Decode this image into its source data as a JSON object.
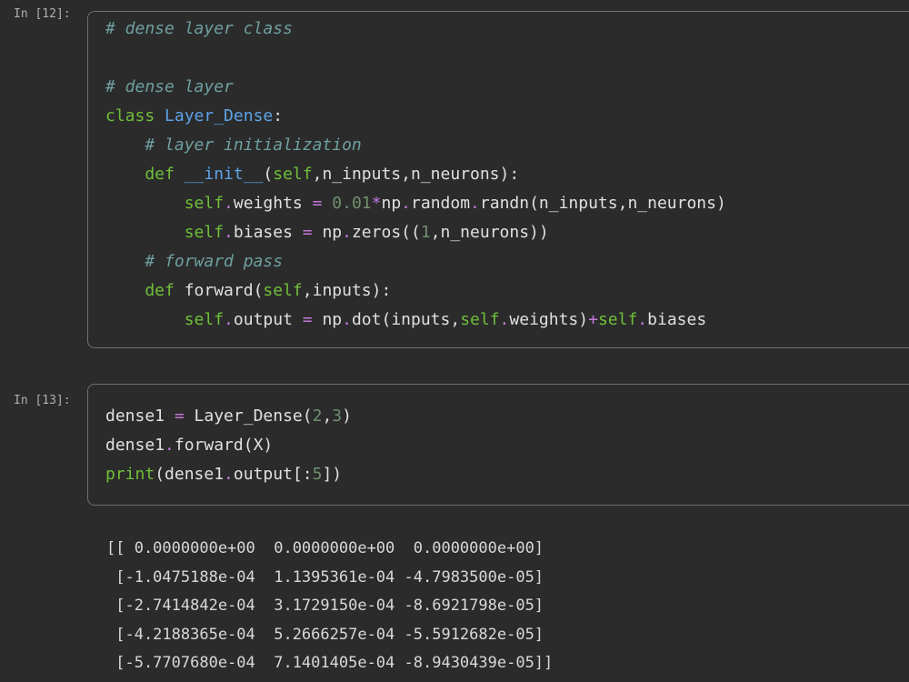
{
  "cells": [
    {
      "prompt": "In [12]:",
      "lines": [
        [
          {
            "t": "# dense layer class",
            "c": "tok-comment"
          }
        ],
        [],
        [
          {
            "t": "# dense layer",
            "c": "tok-comment"
          }
        ],
        [
          {
            "t": "class ",
            "c": "tok-kw"
          },
          {
            "t": "Layer_Dense",
            "c": "tok-cls"
          },
          {
            "t": ":",
            "c": "tok-name"
          }
        ],
        [
          {
            "t": "    # layer initialization",
            "c": "tok-comment"
          }
        ],
        [
          {
            "t": "    def ",
            "c": "tok-kw"
          },
          {
            "t": "__init__",
            "c": "tok-fn"
          },
          {
            "t": "(",
            "c": "tok-name"
          },
          {
            "t": "self",
            "c": "tok-self"
          },
          {
            "t": ",n_inputs,n_neurons):",
            "c": "tok-name"
          }
        ],
        [
          {
            "t": "        self",
            "c": "tok-self"
          },
          {
            "t": ".",
            "c": "tok-op"
          },
          {
            "t": "weights ",
            "c": "tok-name"
          },
          {
            "t": "= ",
            "c": "tok-op"
          },
          {
            "t": "0.01",
            "c": "tok-num"
          },
          {
            "t": "*",
            "c": "tok-op"
          },
          {
            "t": "np",
            "c": "tok-name"
          },
          {
            "t": ".",
            "c": "tok-op"
          },
          {
            "t": "random",
            "c": "tok-name"
          },
          {
            "t": ".",
            "c": "tok-op"
          },
          {
            "t": "randn(n_inputs,n_neurons)",
            "c": "tok-name"
          }
        ],
        [
          {
            "t": "        self",
            "c": "tok-self"
          },
          {
            "t": ".",
            "c": "tok-op"
          },
          {
            "t": "biases ",
            "c": "tok-name"
          },
          {
            "t": "= ",
            "c": "tok-op"
          },
          {
            "t": "np",
            "c": "tok-name"
          },
          {
            "t": ".",
            "c": "tok-op"
          },
          {
            "t": "zeros((",
            "c": "tok-name"
          },
          {
            "t": "1",
            "c": "tok-num"
          },
          {
            "t": ",n_neurons))",
            "c": "tok-name"
          }
        ],
        [
          {
            "t": "    # forward pass",
            "c": "tok-comment"
          }
        ],
        [
          {
            "t": "    def ",
            "c": "tok-kw"
          },
          {
            "t": "forward",
            "c": "tok-name"
          },
          {
            "t": "(",
            "c": "tok-name"
          },
          {
            "t": "self",
            "c": "tok-self"
          },
          {
            "t": ",inputs):",
            "c": "tok-name"
          }
        ],
        [
          {
            "t": "        self",
            "c": "tok-self"
          },
          {
            "t": ".",
            "c": "tok-op"
          },
          {
            "t": "output ",
            "c": "tok-name"
          },
          {
            "t": "= ",
            "c": "tok-op"
          },
          {
            "t": "np",
            "c": "tok-name"
          },
          {
            "t": ".",
            "c": "tok-op"
          },
          {
            "t": "dot(inputs,",
            "c": "tok-name"
          },
          {
            "t": "self",
            "c": "tok-self"
          },
          {
            "t": ".",
            "c": "tok-op"
          },
          {
            "t": "weights)",
            "c": "tok-name"
          },
          {
            "t": "+",
            "c": "tok-op"
          },
          {
            "t": "self",
            "c": "tok-self"
          },
          {
            "t": ".",
            "c": "tok-op"
          },
          {
            "t": "biases",
            "c": "tok-name"
          }
        ]
      ]
    },
    {
      "prompt": "In [13]:",
      "lines": [
        [
          {
            "t": "dense1 ",
            "c": "tok-name"
          },
          {
            "t": "= ",
            "c": "tok-op"
          },
          {
            "t": "Layer_Dense(",
            "c": "tok-name"
          },
          {
            "t": "2",
            "c": "tok-num"
          },
          {
            "t": ",",
            "c": "tok-name"
          },
          {
            "t": "3",
            "c": "tok-num"
          },
          {
            "t": ")",
            "c": "tok-name"
          }
        ],
        [
          {
            "t": "dense1",
            "c": "tok-name"
          },
          {
            "t": ".",
            "c": "tok-op"
          },
          {
            "t": "forward(X)",
            "c": "tok-name"
          }
        ],
        [
          {
            "t": "print",
            "c": "tok-self"
          },
          {
            "t": "(dense1",
            "c": "tok-name"
          },
          {
            "t": ".",
            "c": "tok-op"
          },
          {
            "t": "output[:",
            "c": "tok-name"
          },
          {
            "t": "5",
            "c": "tok-num"
          },
          {
            "t": "])",
            "c": "tok-name"
          }
        ]
      ]
    }
  ],
  "output_lines": [
    "[[ 0.0000000e+00  0.0000000e+00  0.0000000e+00]",
    " [-1.0475188e-04  1.1395361e-04 -4.7983500e-05]",
    " [-2.7414842e-04  3.1729150e-04 -8.6921798e-05]",
    " [-4.2188365e-04  5.2666257e-04 -5.5912682e-05]",
    " [-5.7707680e-04  7.1401405e-04 -8.9430439e-05]]"
  ]
}
